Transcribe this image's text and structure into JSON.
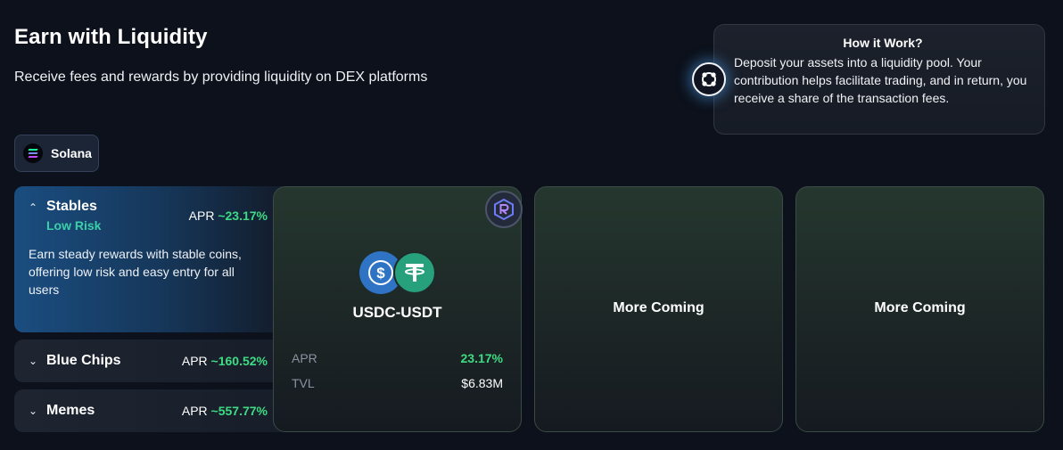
{
  "header": {
    "title": "Earn with Liquidity",
    "subtitle": "Receive fees and rewards by providing liquidity on DEX platforms"
  },
  "info": {
    "icon": "link-nodes-icon",
    "title": "How it Work?",
    "text": "Deposit your assets into a liquidity pool. Your contribution helps facilitate trading, and in return, you receive a share of the transaction fees."
  },
  "chain": {
    "label": "Solana",
    "icon": "solana-icon"
  },
  "categories": [
    {
      "name": "Stables",
      "risk": "Low Risk",
      "apr_label": "APR",
      "apr_value": "~23.17%",
      "description": "Earn steady rewards with stable coins, offering low risk and easy entry for all users",
      "expanded": true
    },
    {
      "name": "Blue Chips",
      "apr_label": "APR",
      "apr_value": "~160.52%",
      "expanded": false
    },
    {
      "name": "Memes",
      "apr_label": "APR",
      "apr_value": "~557.77%",
      "expanded": false
    }
  ],
  "pools": [
    {
      "pair": "USDC-USDT",
      "dex_icon": "raydium-icon",
      "apr_label": "APR",
      "apr_value": "23.17%",
      "tvl_label": "TVL",
      "tvl_value": "$6.83M"
    }
  ],
  "placeholders": [
    "More Coming",
    "More Coming"
  ],
  "colors": {
    "background": "#0c111b",
    "accent_green": "#3ddc84",
    "risk_teal": "#3ad0a8",
    "active_blue": "#1a4d80"
  }
}
